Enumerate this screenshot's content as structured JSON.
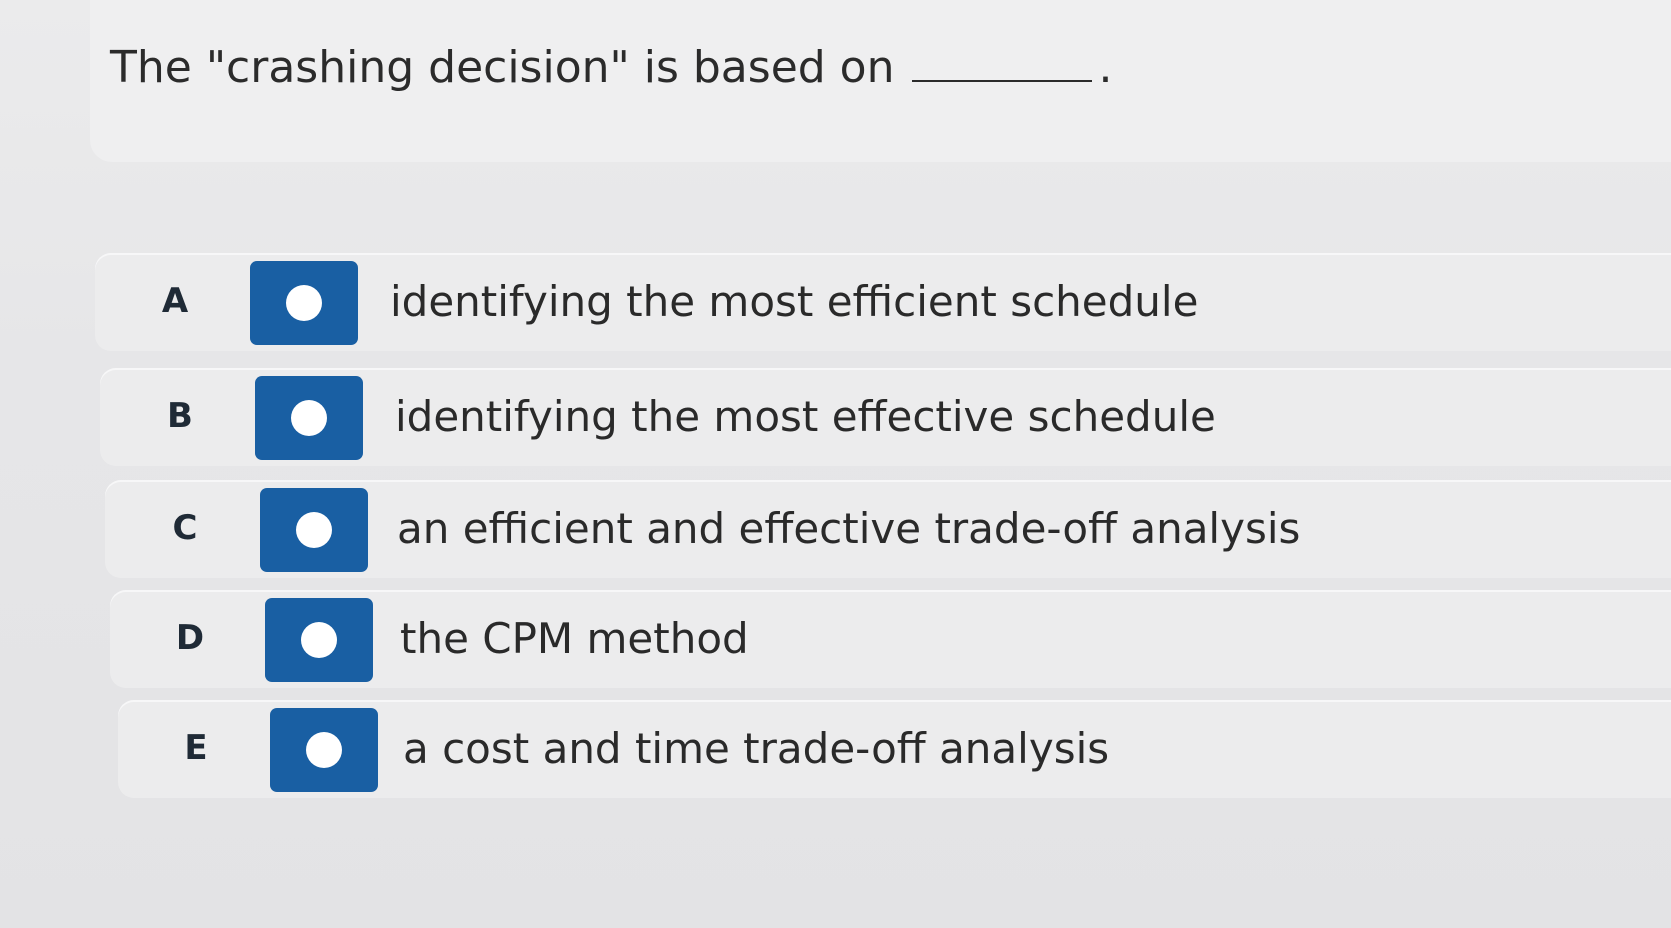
{
  "question": {
    "text": "The \"crashing decision\" is based on",
    "terminal": "."
  },
  "options": [
    {
      "letter": "A",
      "text": "identifying the most efficient schedule"
    },
    {
      "letter": "B",
      "text": "identifying the most effective schedule"
    },
    {
      "letter": "C",
      "text": "an efficient and effective trade-off analysis"
    },
    {
      "letter": "D",
      "text": "the CPM method"
    },
    {
      "letter": "E",
      "text": "a cost and time trade-off analysis"
    }
  ],
  "colors": {
    "radio_fill": "#195fa3",
    "radio_dot": "#ffffff",
    "background": "#e4e4e5"
  }
}
